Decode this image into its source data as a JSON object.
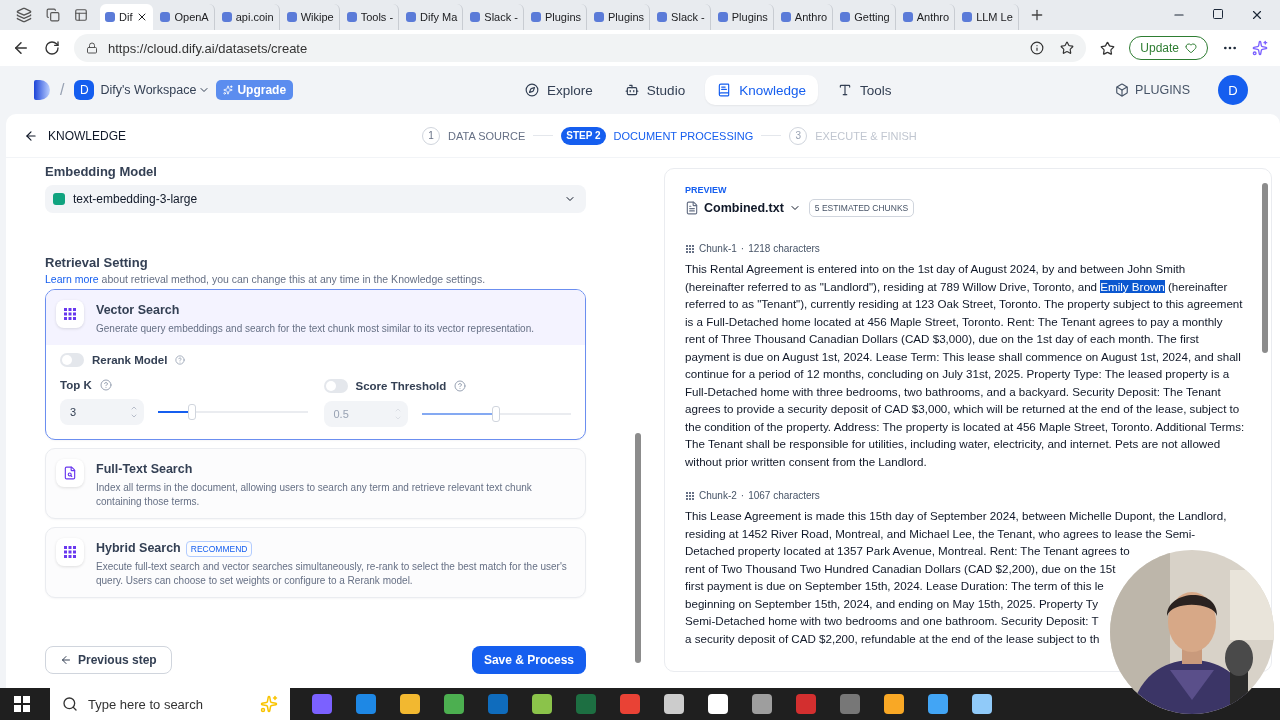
{
  "browser": {
    "tabs": [
      {
        "label": "Dif",
        "selected": true
      },
      {
        "label": "OpenA",
        "selected": false
      },
      {
        "label": "api.coin",
        "selected": false
      },
      {
        "label": "Wikipe",
        "selected": false
      },
      {
        "label": "Tools -",
        "selected": false
      },
      {
        "label": "Dify Ma",
        "selected": false
      },
      {
        "label": "Slack -",
        "selected": false
      },
      {
        "label": "Plugins",
        "selected": false
      },
      {
        "label": "Plugins",
        "selected": false
      },
      {
        "label": "Slack -",
        "selected": false
      },
      {
        "label": "Plugins",
        "selected": false
      },
      {
        "label": "Anthro",
        "selected": false
      },
      {
        "label": "Getting",
        "selected": false
      },
      {
        "label": "Anthro",
        "selected": false
      },
      {
        "label": "LLM Le",
        "selected": false
      }
    ],
    "url": "https://cloud.dify.ai/datasets/create",
    "update_button": "Update"
  },
  "app_header": {
    "separator": "/",
    "workspace_initial": "D",
    "workspace": "Dify's Workspace",
    "upgrade": "Upgrade",
    "nav": [
      {
        "label": "Explore",
        "selected": false
      },
      {
        "label": "Studio",
        "selected": false
      },
      {
        "label": "Knowledge",
        "selected": true
      },
      {
        "label": "Tools",
        "selected": false
      }
    ],
    "plugins": "PLUGINS",
    "avatar": "D"
  },
  "steps_bar": {
    "back_label": "KNOWLEDGE",
    "steps": [
      {
        "number": "1",
        "label": "DATA SOURCE",
        "selected": false,
        "disabled": false
      },
      {
        "number": "STEP 2",
        "label": "DOCUMENT PROCESSING",
        "selected": true,
        "disabled": false
      },
      {
        "number": "3",
        "label": "EXECUTE & FINISH",
        "selected": false,
        "disabled": true
      }
    ]
  },
  "embedding": {
    "label": "Embedding Model",
    "model": "text-embedding-3-large"
  },
  "retrieval": {
    "title": "Retrieval Setting",
    "learn_more": "Learn more",
    "description": " about retrieval method, you can change this at any time in the Knowledge settings.",
    "options": [
      {
        "kind": "vector",
        "title": "Vector Search",
        "description": "Generate query embeddings and search for the text chunk most similar to its vector representation.",
        "selected": true
      },
      {
        "kind": "fulltext",
        "title": "Full-Text Search",
        "description": "Index all terms in the document, allowing users to search any term and retrieve relevant text chunk containing those terms.",
        "selected": false
      },
      {
        "kind": "hybrid",
        "title": "Hybrid Search",
        "badge": "RECOMMEND",
        "description": "Execute full-text search and vector searches simultaneously, re-rank to select the best match for the user's query. Users can choose to set weights or configure to a Rerank model.",
        "selected": false
      }
    ],
    "rerank": {
      "label": "Rerank Model",
      "on": false
    },
    "top_k": {
      "label": "Top K",
      "value": "3",
      "level": 0.23
    },
    "score_threshold": {
      "label": "Score Threshold",
      "on": false,
      "value": "0.5",
      "level": 0.5
    }
  },
  "buttons": {
    "previous": "Previous step",
    "save": "Save & Process"
  },
  "preview": {
    "label": "PREVIEW",
    "file": "Combined.txt",
    "chunks_badge": "5 ESTIMATED CHUNKS",
    "chunks": [
      {
        "title": "Chunk-1",
        "separator": "·",
        "count": "1218 characters",
        "segments": [
          {
            "text": "This Rental Agreement is entered into on the 1st day of August 2024, by and between John Smith (hereinafter referred to as \"Landlord\"), residing at 789 Willow Drive, Toronto, and ",
            "highlighted": false
          },
          {
            "text": "Emily Brown",
            "highlighted": true
          },
          {
            "text": " (hereinafter referred to as \"Tenant\"), currently residing at 123 Oak Street, Toronto. The property subject to this agreement is a Full-Detached home located at 456 Maple Street, Toronto. Rent: The Tenant agrees to pay a monthly rent of Three Thousand Canadian Dollars (CAD $3,000), due on the 1st day of each month. The first payment is due on August 1st, 2024. Lease Term: This lease shall commence on August 1st, 2024, and shall continue for a period of 12 months, concluding on July 31st, 2025. Property Type: The leased property is a Full-Detached home with three bedrooms, two bathrooms, and a backyard. Security Deposit: The Tenant agrees to provide a security deposit of CAD $3,000, which will be returned at the end of the lease, subject to the condition of the property. Address: The property is located at 456 Maple Street, Toronto. Additional Terms: The Tenant shall be responsible for utilities, including water, electricity, and internet. Pets are not allowed without prior written consent from the Landlord.",
            "highlighted": false
          }
        ]
      },
      {
        "title": "Chunk-2",
        "separator": "·",
        "count": "1067 characters",
        "lines": [
          "This Lease Agreement is made this 15th day of September 2024, between Michelle Dupont, the Landlord,",
          "residing at 1452 River Road, Montreal, and Michael Lee, the Tenant, who agrees to lease the Semi-",
          "Detached property located at 1357 Park Avenue, Montreal. Rent: The Tenant agrees to",
          "rent of Two Thousand Two Hundred Canadian Dollars (CAD $2,200), due on the 15t",
          "first payment is due on September 15th, 2024. Lease Duration: The term of this le",
          "beginning on September 15th, 2024, and ending on May 15th, 2025. Property Ty",
          "Semi-Detached home with two bedrooms and one bathroom. Security Deposit: T",
          "a security deposit of CAD $2,200, refundable at the end of the lease subject to th"
        ]
      }
    ]
  },
  "taskbar": {
    "search_placeholder": "Type here to search"
  }
}
